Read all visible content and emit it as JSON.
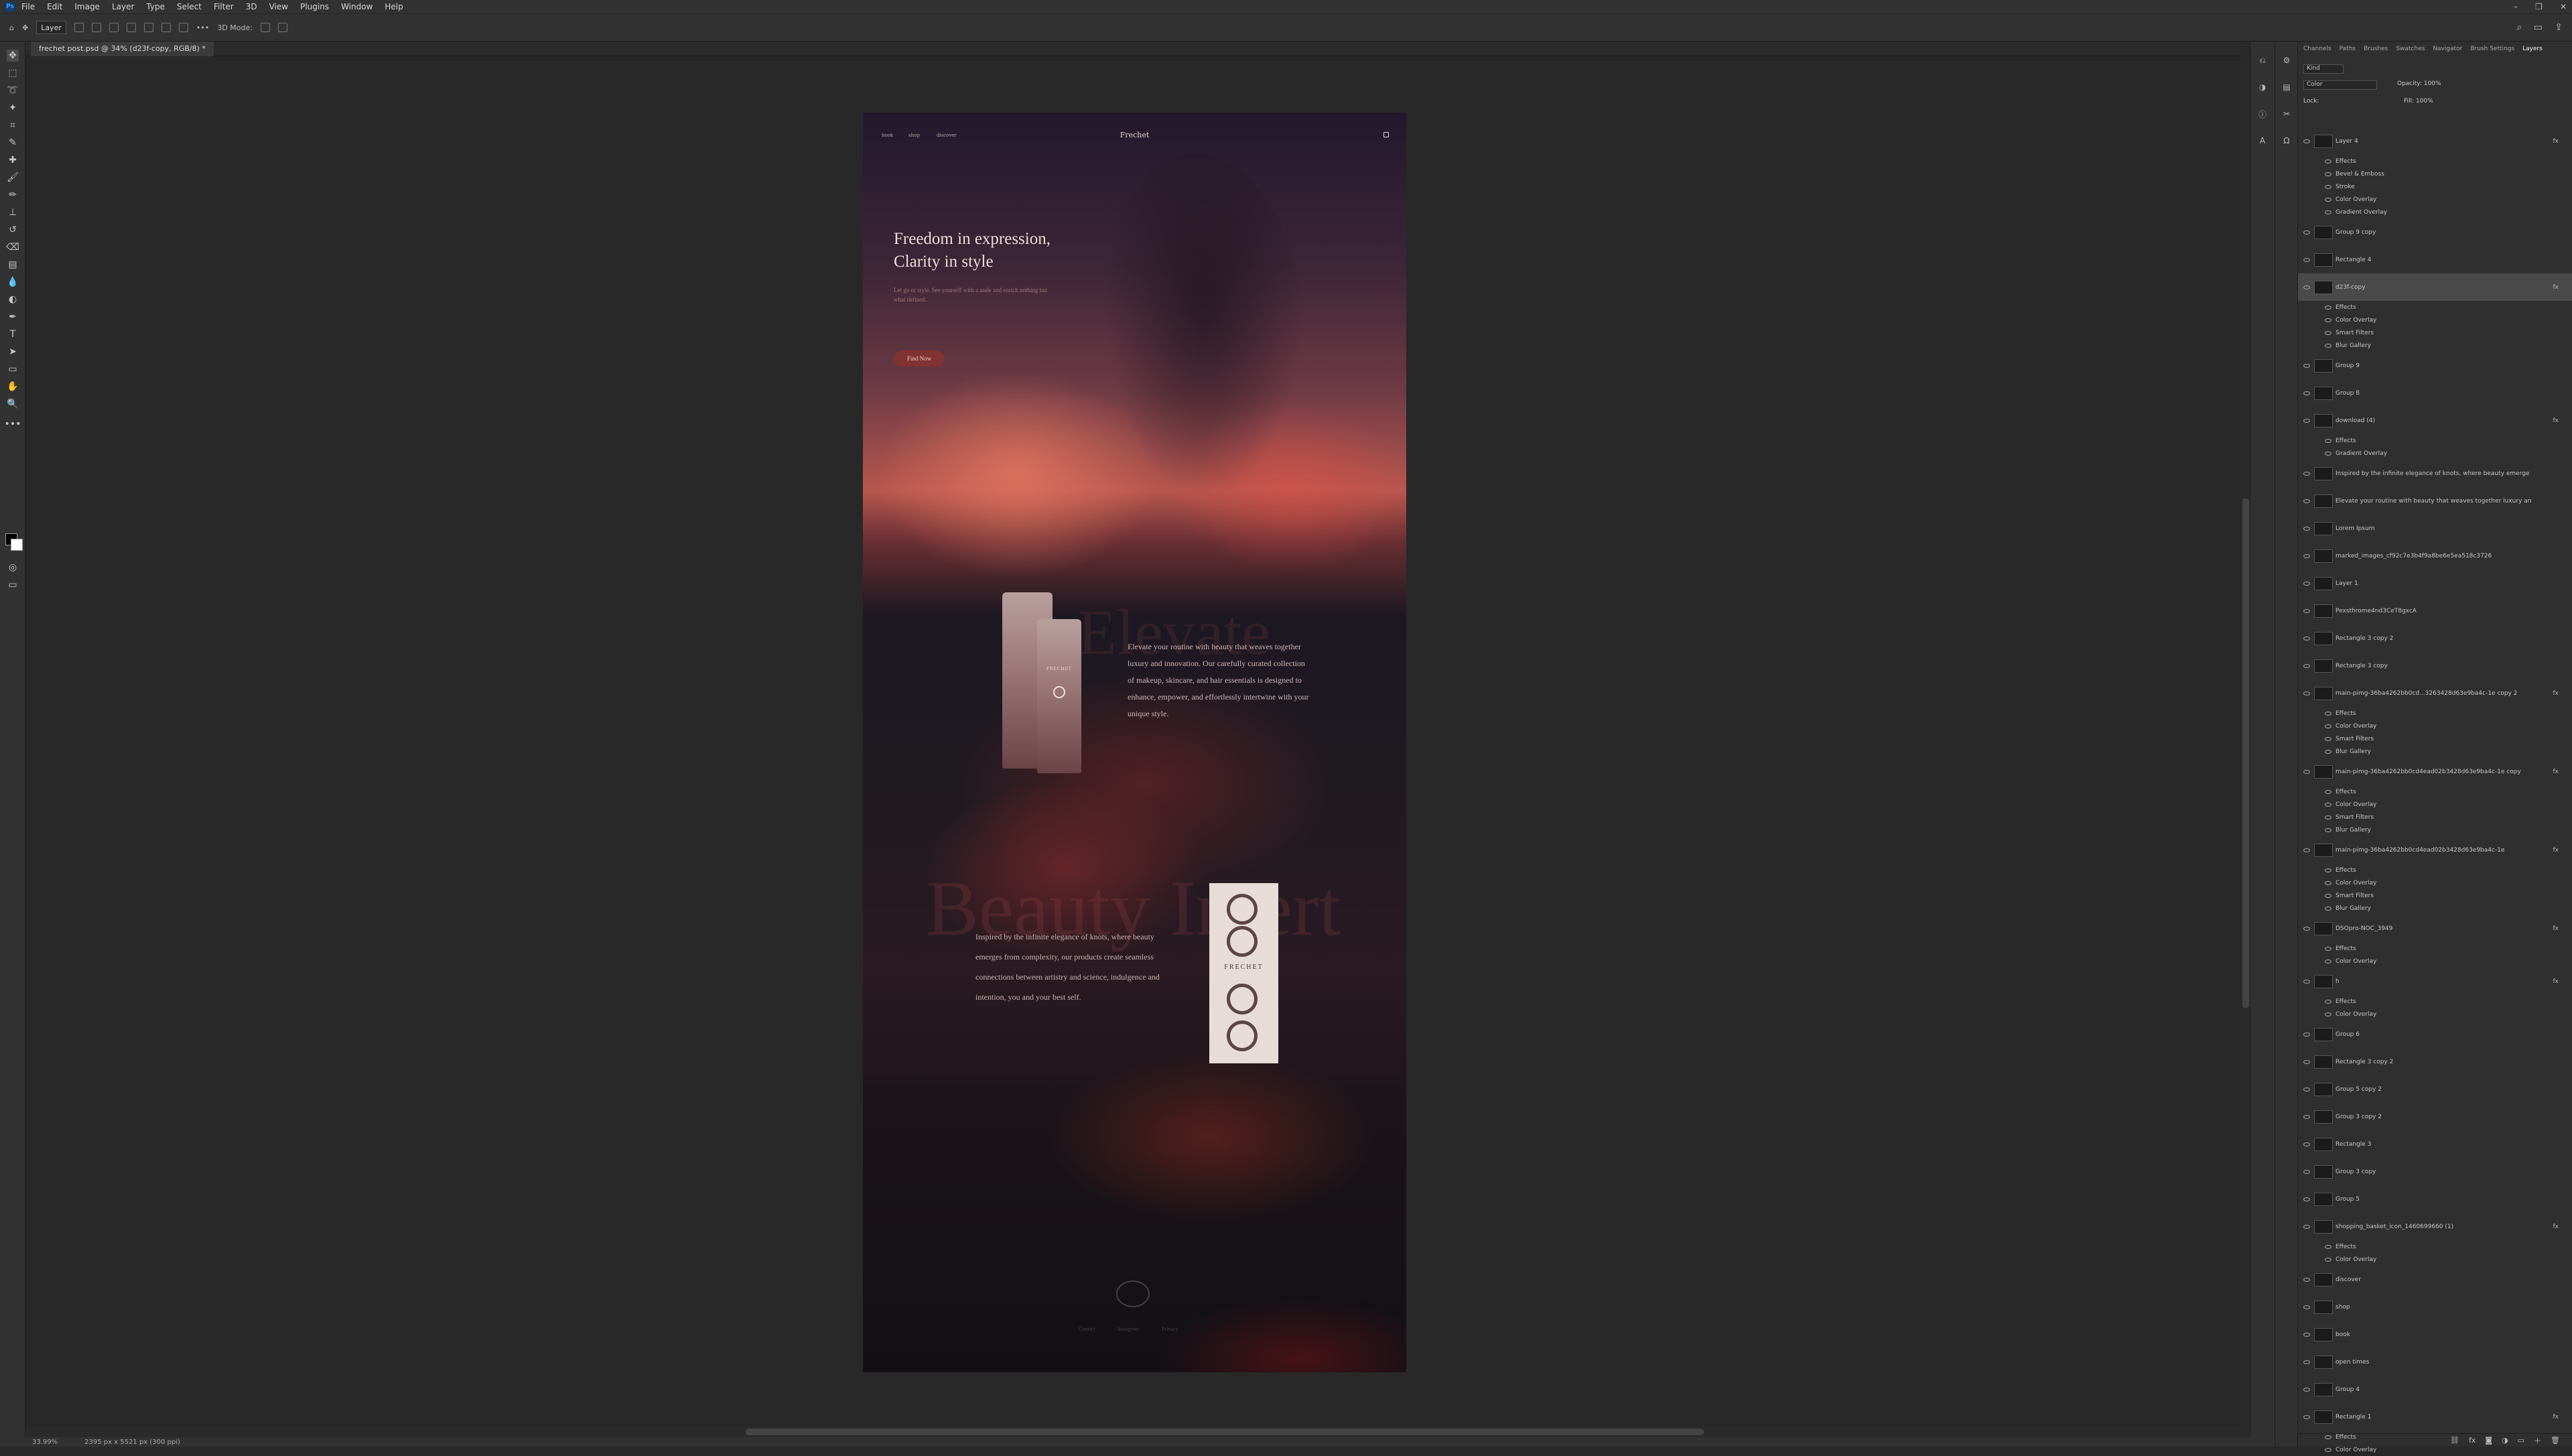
{
  "app": {
    "logo": "Ps"
  },
  "menubar": {
    "items": [
      "File",
      "Edit",
      "Image",
      "Layer",
      "Type",
      "Select",
      "Filter",
      "3D",
      "View",
      "Plugins",
      "Window",
      "Help"
    ]
  },
  "optionsbar": {
    "layer_select": "Layer",
    "mode3d": "3D Mode:",
    "more": "•••"
  },
  "document_tab": {
    "label": "frechet post.psd @ 34% (d23f-copy, RGB/8) *"
  },
  "status": {
    "zoom": "33.99%",
    "size": "2395 px x 5521 px (300 ppi)"
  },
  "design": {
    "nav": [
      "book",
      "shop",
      "discover"
    ],
    "brand": "Frechet",
    "hero_title": "Freedom in expression, Clarity in style",
    "hero_sub": "Let go or style. See yourself with a nude and enrich nothing but what defined.",
    "cta": "Find Now",
    "elevate": "Elevate",
    "beauty": "Beauty Intert",
    "p2": "Elevate your routine with beauty that weaves together luxury and innovation. Our carefully curated collection of makeup, skincare, and hair essentials is designed to enhance, empower, and effortlessly intertwine with your unique style.",
    "p3": "Inspired by the infinite elegance of knots, where beauty emerges from complexity, our products create seamless connections between artistry and science, indulgence and intention, you and your best self.",
    "box_brand": "FRECHET",
    "tube_text": "FRECHET",
    "footer": [
      "Contact",
      "Instagram",
      "Privacy"
    ]
  },
  "layers_panel": {
    "tabs": [
      "Channels",
      "Paths",
      "Brushes",
      "Swatches",
      "Navigator",
      "Brush Settings",
      "Layers"
    ],
    "kind": "Kind",
    "blend": "Color",
    "opacity": "Opacity: 100%",
    "lock": "Lock:",
    "fill": "Fill: 100%",
    "rows": [
      {
        "name": "Layer 4",
        "fx": "fx"
      },
      {
        "name": "Effects"
      },
      {
        "name": "Bevel & Emboss"
      },
      {
        "name": "Stroke"
      },
      {
        "name": "Color Overlay"
      },
      {
        "name": "Gradient Overlay"
      },
      {
        "name": "Group 9 copy"
      },
      {
        "name": "Rectangle 4"
      },
      {
        "name": "d23f-copy",
        "fx": "fx"
      },
      {
        "name": "Effects"
      },
      {
        "name": "Color Overlay"
      },
      {
        "name": "Smart Filters"
      },
      {
        "name": "Blur Gallery"
      },
      {
        "name": "Group 9"
      },
      {
        "name": "Group 8"
      },
      {
        "name": "download (4)",
        "fx": "fx"
      },
      {
        "name": "Effects"
      },
      {
        "name": "Gradient Overlay"
      },
      {
        "name": "Inspired by the infinite elegance of knots, where beauty emerge"
      },
      {
        "name": "Elevate your routine with beauty that weaves together luxury an"
      },
      {
        "name": "Lorem Ipsum"
      },
      {
        "name": "marked_images_cf92c7e3b4f9a8be6e5ea518c3726"
      },
      {
        "name": "Layer 1"
      },
      {
        "name": "Pexsthrome4nd3CeT8gxcA"
      },
      {
        "name": "Rectangle 3 copy 2"
      },
      {
        "name": "Rectangle 3 copy"
      },
      {
        "name": "main-pimg-36ba4262bb0cd...3263428d63e9ba4c-1e copy 2",
        "fx": "fx"
      },
      {
        "name": "Effects"
      },
      {
        "name": "Color Overlay"
      },
      {
        "name": "Smart Filters"
      },
      {
        "name": "Blur Gallery"
      },
      {
        "name": "main-pimg-36ba4262bb0cd4ead02b3428d63e9ba4c-1e copy",
        "fx": "fx"
      },
      {
        "name": "Effects"
      },
      {
        "name": "Color Overlay"
      },
      {
        "name": "Smart Filters"
      },
      {
        "name": "Blur Gallery"
      },
      {
        "name": "main-pimg-36ba4262bb0cd4ead02b3428d63e9ba4c-1e",
        "fx": "fx"
      },
      {
        "name": "Effects"
      },
      {
        "name": "Color Overlay"
      },
      {
        "name": "Smart Filters"
      },
      {
        "name": "Blur Gallery"
      },
      {
        "name": "DSOpro-NOC_3949",
        "fx": "fx"
      },
      {
        "name": "Effects"
      },
      {
        "name": "Color Overlay"
      },
      {
        "name": "h",
        "fx": "fx"
      },
      {
        "name": "Effects"
      },
      {
        "name": "Color Overlay"
      },
      {
        "name": "Group 6"
      },
      {
        "name": "Rectangle 3 copy 2"
      },
      {
        "name": "Group 5 copy 2"
      },
      {
        "name": "Group 3 copy 2"
      },
      {
        "name": "Rectangle 3"
      },
      {
        "name": "Group 3 copy"
      },
      {
        "name": "Group 5"
      },
      {
        "name": "shopping_basket_icon_1460699660 (1)",
        "fx": "fx"
      },
      {
        "name": "Effects"
      },
      {
        "name": "Color Overlay"
      },
      {
        "name": "discover"
      },
      {
        "name": "shop"
      },
      {
        "name": "book"
      },
      {
        "name": "open times"
      },
      {
        "name": "Group 4"
      },
      {
        "name": "Rectangle 1",
        "fx": "fx"
      },
      {
        "name": "Effects"
      },
      {
        "name": "Color Overlay"
      }
    ]
  }
}
